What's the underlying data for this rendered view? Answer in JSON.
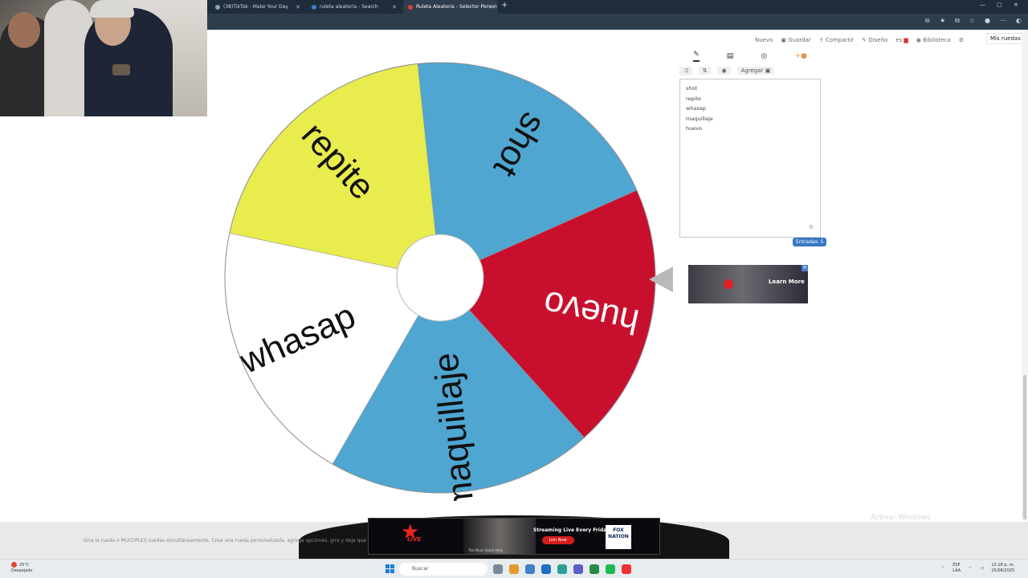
{
  "browser": {
    "tabs": [
      {
        "label": "(38)TikTok - Make Your Day",
        "active": false
      },
      {
        "label": "ruleta aleatoria - Search",
        "active": false
      },
      {
        "label": "Ruleta Aleatoria - Selector Person",
        "active": true
      }
    ]
  },
  "nav": {
    "items": [
      "Nuevo",
      "Guardar",
      "Compartir",
      "Diseño",
      "es"
    ],
    "library": "Biblioteca",
    "my_wheels": "Mis ruedas"
  },
  "wheel": {
    "segments": [
      {
        "label": "shot",
        "color": "#4ea6d1"
      },
      {
        "label": "huevo",
        "color": "#c8102e"
      },
      {
        "label": "maquillaje",
        "color": "#4ea6d1"
      },
      {
        "label": "whasap",
        "color": "#ffffff"
      },
      {
        "label": "repite",
        "color": "#e8ec4c"
      }
    ]
  },
  "panel": {
    "add_label": "Agregar",
    "entries": [
      "shot",
      "repite",
      "whasap",
      "maquillaje",
      "huevo"
    ],
    "count_label": "Entradas: 5"
  },
  "ad_small": {
    "cta": "Learn More"
  },
  "footer": {
    "text": "Gira la rueda o MÚLTIPLES ruedas simultáneamente. Crea una rueda personalizada, agrega opciones, gira y deja que la suerte decida el resultado."
  },
  "banner": {
    "brand": "LIVE",
    "tagline": "The Muck Starts Here",
    "headline": "Streaming Live Every Friday",
    "cta": "Join Now",
    "partner_top": "FOX",
    "partner_bottom": "NATION"
  },
  "watermark": "Activar Windows",
  "taskbar": {
    "weather_temp": "25°C",
    "weather_desc": "Despejado",
    "search_placeholder": "Buscar",
    "lang": "ESP",
    "lang_sub": "LAA",
    "time": "12:18 p. m.",
    "date": "25/08/2025"
  }
}
